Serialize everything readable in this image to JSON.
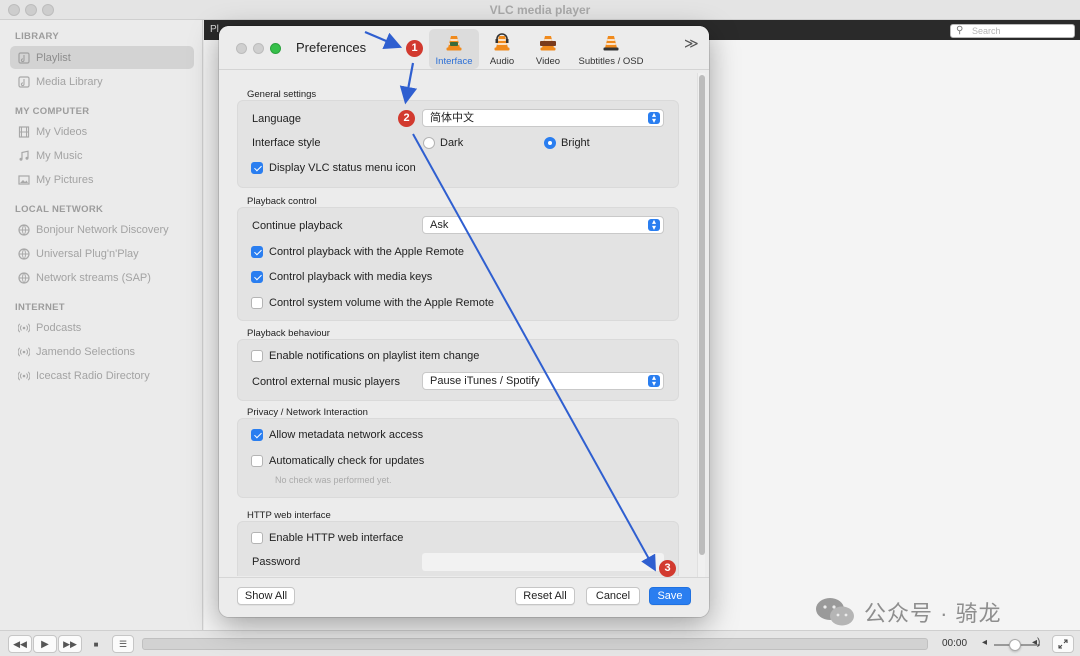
{
  "window": {
    "title": "VLC media player",
    "playlist_label": "Pl",
    "search_placeholder": "Search"
  },
  "sidebar": {
    "sections": [
      {
        "heading": "LIBRARY",
        "items": [
          {
            "label": "Playlist",
            "icon": "playlist-icon",
            "selected": true
          },
          {
            "label": "Media Library",
            "icon": "playlist-icon"
          }
        ]
      },
      {
        "heading": "MY COMPUTER",
        "items": [
          {
            "label": "My Videos",
            "icon": "film-icon"
          },
          {
            "label": "My Music",
            "icon": "music-note-icon"
          },
          {
            "label": "My Pictures",
            "icon": "picture-icon"
          }
        ]
      },
      {
        "heading": "LOCAL NETWORK",
        "items": [
          {
            "label": "Bonjour Network Discovery",
            "icon": "network-icon"
          },
          {
            "label": "Universal Plug'n'Play",
            "icon": "network-icon"
          },
          {
            "label": "Network streams (SAP)",
            "icon": "network-icon"
          }
        ]
      },
      {
        "heading": "INTERNET",
        "items": [
          {
            "label": "Podcasts",
            "icon": "broadcast-icon"
          },
          {
            "label": "Jamendo Selections",
            "icon": "broadcast-icon"
          },
          {
            "label": "Icecast Radio Directory",
            "icon": "broadcast-icon"
          }
        ]
      }
    ]
  },
  "player": {
    "time": "00:00",
    "volume": 0.45,
    "buttons": {
      "rewind": "◀◀",
      "play": "▶",
      "forward": "▶▶",
      "stop": "■",
      "playlist": "☰"
    }
  },
  "prefs": {
    "title": "Preferences",
    "tabs": [
      {
        "label": "Interface",
        "active": true
      },
      {
        "label": "Audio"
      },
      {
        "label": "Video"
      },
      {
        "label": "Subtitles / OSD"
      }
    ],
    "more": "≫",
    "general": {
      "title": "General settings",
      "language_label": "Language",
      "language_value": "简体中文",
      "style_label": "Interface style",
      "style_dark": "Dark",
      "style_bright": "Bright",
      "status_menu": "Display VLC status menu icon"
    },
    "playback_control": {
      "title": "Playback control",
      "continue_label": "Continue playback",
      "continue_value": "Ask",
      "apple_remote": "Control playback with the Apple Remote",
      "media_keys": "Control playback with media keys",
      "system_volume": "Control system volume with the Apple Remote"
    },
    "playback_behaviour": {
      "title": "Playback behaviour",
      "notifications": "Enable notifications on playlist item change",
      "external_label": "Control external music players",
      "external_value": "Pause iTunes / Spotify"
    },
    "privacy": {
      "title": "Privacy / Network Interaction",
      "metadata": "Allow metadata network access",
      "updates": "Automatically check for updates",
      "updates_note": "No check was performed yet."
    },
    "http": {
      "title": "HTTP web interface",
      "enable": "Enable HTTP web interface",
      "password_label": "Password"
    },
    "footer": {
      "show_all": "Show All",
      "reset_all": "Reset All",
      "cancel": "Cancel",
      "save": "Save"
    }
  },
  "annotations": {
    "badge1": "1",
    "badge2": "2",
    "badge3": "3",
    "arrow_color": "#2f5fd0"
  },
  "watermark": {
    "text": "公众号 · 骑龙"
  },
  "colors": {
    "accent": "#2a7ef0",
    "badge": "#d23a2f"
  }
}
